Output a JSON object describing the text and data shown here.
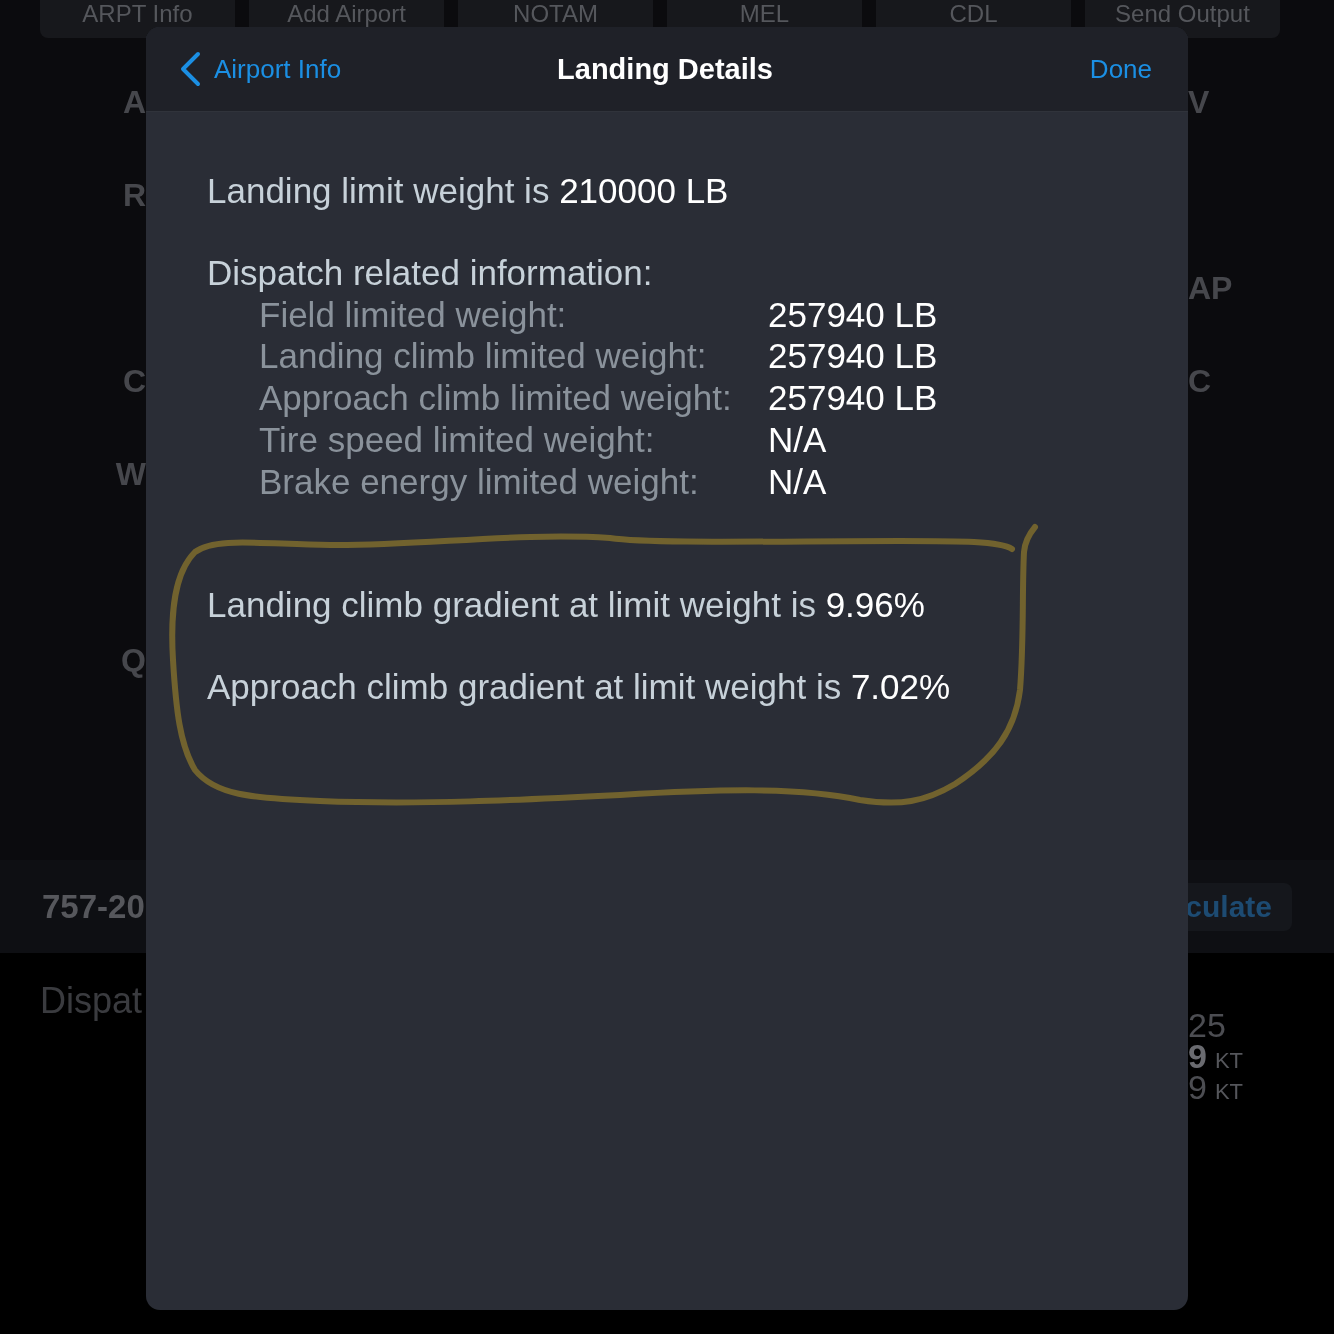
{
  "background": {
    "toolbar": [
      "ARPT Info",
      "Add Airport",
      "NOTAM",
      "MEL",
      "CDL",
      "Send Output"
    ],
    "left_labels": [
      "A",
      "R",
      "C",
      "W",
      "Q"
    ],
    "right_labels": [
      "V",
      "AP",
      "C"
    ],
    "aircraft": "757-20",
    "calculate_button": "culate",
    "section_title": "Dispat",
    "readings": [
      {
        "value": "25",
        "kind": "plain"
      },
      {
        "value": "9",
        "unit": "KT",
        "kind": "strong"
      },
      {
        "value": "9",
        "unit": "KT",
        "kind": "plain"
      }
    ]
  },
  "modal": {
    "back_label": "Airport Info",
    "title": "Landing Details",
    "done_label": "Done",
    "summary": {
      "text": "Landing limit weight is",
      "value": "210000 LB"
    },
    "dispatch_heading": "Dispatch related information:",
    "dispatch_rows": [
      {
        "label": "Field limited weight:",
        "value": "257940 LB"
      },
      {
        "label": "Landing climb limited weight:",
        "value": "257940 LB"
      },
      {
        "label": "Approach climb limited weight:",
        "value": "257940 LB"
      },
      {
        "label": "Tire speed limited weight:",
        "value": "N/A"
      },
      {
        "label": "Brake energy limited weight:",
        "value": "N/A"
      }
    ],
    "gradients": [
      {
        "text": "Landing climb gradient at limit weight is",
        "value": "9.96%"
      },
      {
        "text": "Approach climb gradient at limit weight is",
        "value": "7.02%"
      }
    ]
  }
}
